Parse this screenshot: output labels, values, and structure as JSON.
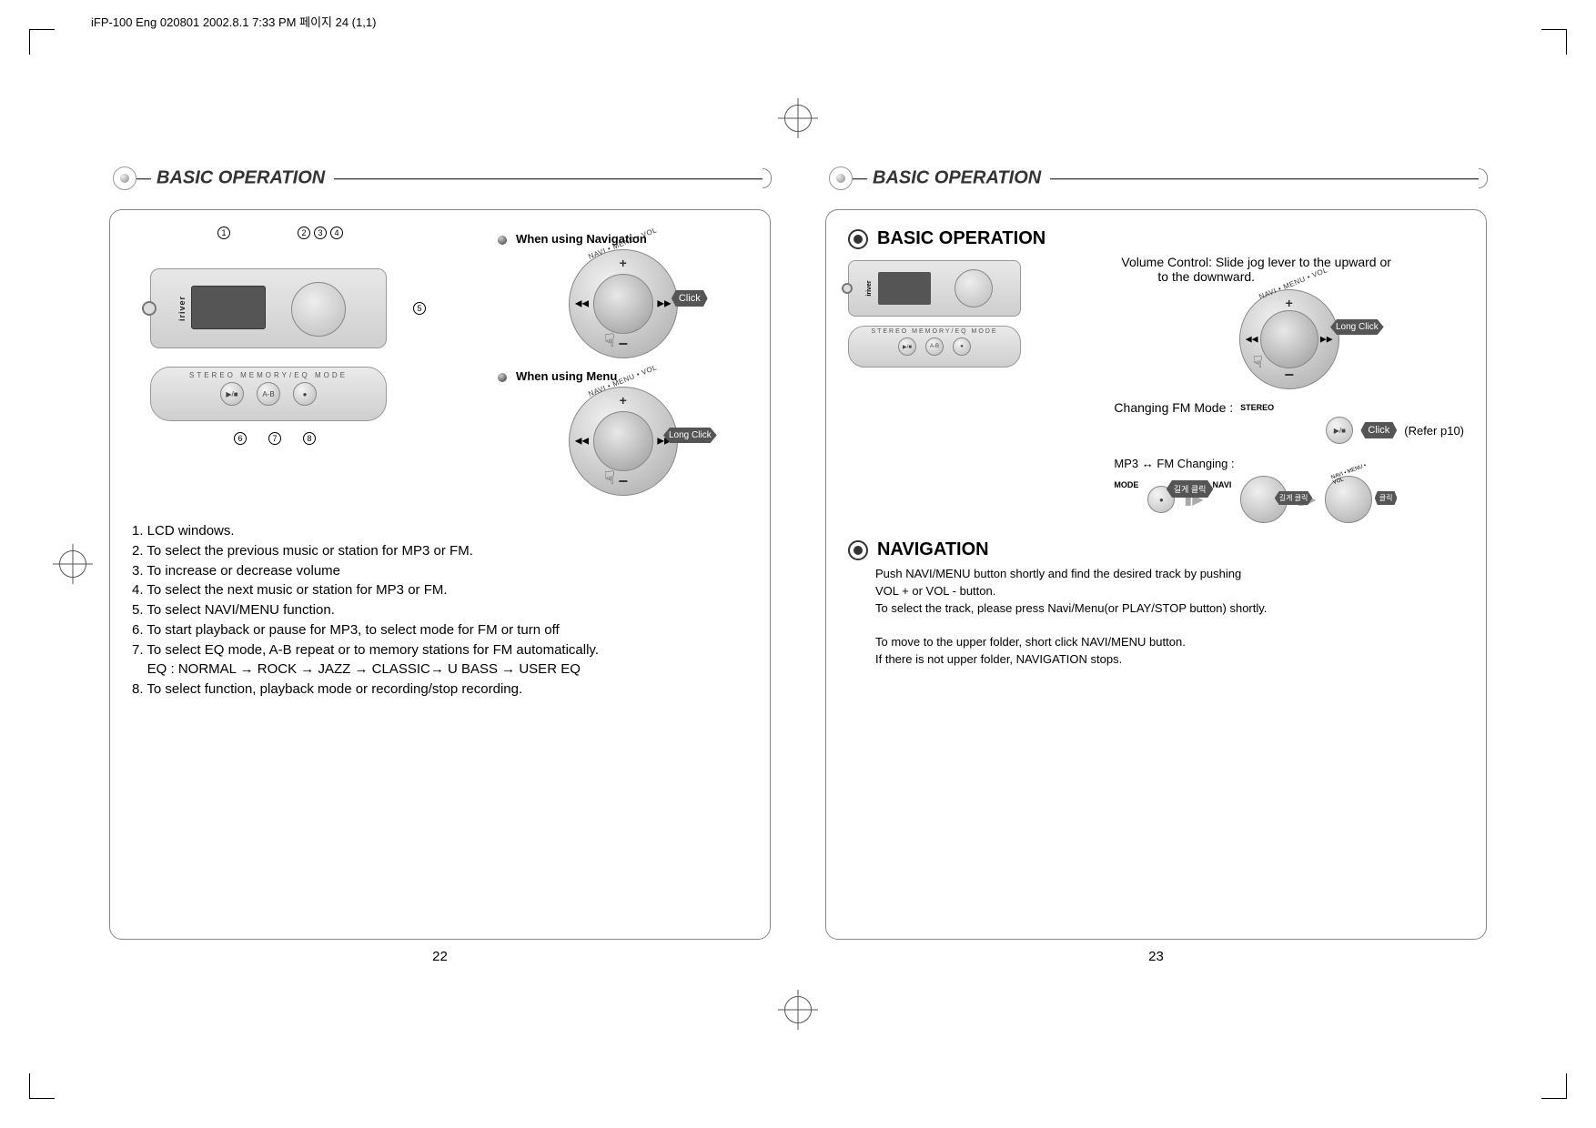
{
  "filepath": "iFP-100 Eng 020801  2002.8.1 7:33 PM  페이지 24 (1,1)",
  "left": {
    "header": "BASIC OPERATION",
    "callouts_top": [
      "1",
      "2",
      "3",
      "4"
    ],
    "callouts_side": "5",
    "callouts_bottom": [
      "6",
      "7",
      "8"
    ],
    "bottom_labels": "STEREO   MEMORY/EQ    MODE",
    "btn_labels": [
      "▶/■",
      "A-B",
      "●"
    ],
    "device_brand": "iriver",
    "jog_arc": "NAVI • MENU • VOL",
    "nav_heading": "When using Navigation",
    "nav_burst": "Click",
    "menu_heading": "When using Menu",
    "menu_burst": "Long Click",
    "list": [
      "1. LCD windows.",
      "2. To select the previous music or station for MP3 or FM.",
      "3. To increase or decrease volume",
      "4. To select the next music or station for MP3 or FM.",
      "5. To select NAVI/MENU function.",
      "6. To start playback or pause for MP3, to select mode for FM or turn off",
      "7. To select EQ mode, A-B repeat or to memory stations for FM automatically.",
      "    EQ : NORMAL → ROCK → JAZZ → CLASSIC→ U BASS → USER EQ",
      "8. To select function, playback mode or recording/stop recording."
    ],
    "pagenum": "22"
  },
  "right": {
    "header": "BASIC OPERATION",
    "sec1_title": "BASIC OPERATION",
    "vol_text_1": "Volume Control: Slide jog lever to the upward or",
    "vol_text_2": "to the downward.",
    "jog_arc": "NAVI • MENU • VOL",
    "vol_burst": "Long Click",
    "fm_label": "Changing FM Mode :",
    "stereo": "STEREO",
    "fm_btn": "▶/■",
    "fm_burst": "Click",
    "fm_refer": "(Refer p10)",
    "mp3_label": "MP3 ↔ FM Changing :",
    "mode_lbl": "MODE",
    "navi_lbl": "NAVI",
    "mode_burst1": "길게 클릭",
    "mode_burst2": "길게 클릭",
    "mode_burst3": "클릭",
    "sec2_title": "NAVIGATION",
    "nav_p1": "Push NAVI/MENU button shortly and find the desired track by pushing",
    "nav_p2": "VOL + or VOL - button.",
    "nav_p3": "To select the track, please press Navi/Menu(or PLAY/STOP button) shortly.",
    "nav_p4": "To move to the upper folder, short click NAVI/MENU button.",
    "nav_p5": "If there is not upper folder, NAVIGATION stops.",
    "bottom_labels": "STEREO  MEMORY/EQ  MODE",
    "pagenum": "23"
  }
}
